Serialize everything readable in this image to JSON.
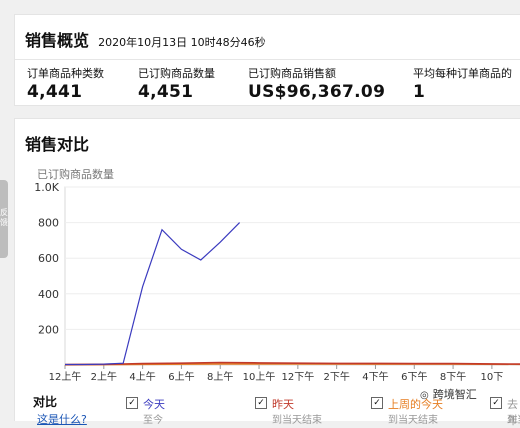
{
  "sales_overview": {
    "title": "销售概览",
    "timestamp": "2020年10月13日 10时48分46秒",
    "metrics": [
      {
        "label": "订单商品种类数",
        "value": "4,441"
      },
      {
        "label": "已订购商品数量",
        "value": "4,451"
      },
      {
        "label": "已订购商品销售额",
        "value": "US$96,367.09"
      },
      {
        "label": "平均每种订单商品的",
        "value": "1"
      }
    ]
  },
  "sales_comparison": {
    "title": "销售对比",
    "legend_title": "对比",
    "legend_link": "这是什么?",
    "series_labels": [
      {
        "name": "今天",
        "sub": "至今",
        "color": "#3b3bbf"
      },
      {
        "name": "昨天",
        "sub": "到当天结束",
        "color": "#c0392b"
      },
      {
        "name": "上周的今天",
        "sub": "到当天结束",
        "color": "#e67e22"
      },
      {
        "name": "去年",
        "sub": "到当",
        "color": "#999999"
      }
    ]
  },
  "chart_data": {
    "type": "line",
    "ylabel": "已订购商品数量",
    "ylim": [
      0,
      1000
    ],
    "yticks": [
      0,
      200,
      400,
      600,
      800,
      1000
    ],
    "ytick_labels": [
      "",
      "200",
      "400",
      "600",
      "800",
      "1.0K"
    ],
    "xticks": [
      0,
      2,
      4,
      6,
      8,
      10,
      12,
      14,
      16,
      18,
      20,
      22
    ],
    "xtick_labels": [
      "12上午",
      "2上午",
      "4上午",
      "6上午",
      "8上午",
      "10上午",
      "12下午",
      "2下午",
      "4下午",
      "6下午",
      "8下午",
      "10下"
    ],
    "xlim": [
      0,
      23.5
    ],
    "series": [
      {
        "name": "今天",
        "color": "#3b3bbf",
        "x": [
          0,
          1,
          2,
          3,
          4,
          5,
          6,
          7,
          8,
          9
        ],
        "y": [
          3,
          3,
          5,
          10,
          440,
          760,
          650,
          590,
          690,
          800
        ]
      },
      {
        "name": "昨天",
        "color": "#c0392b",
        "x": [
          0,
          2,
          4,
          6,
          8,
          10,
          12,
          14,
          16,
          18,
          20,
          22,
          23.5
        ],
        "y": [
          2,
          4,
          8,
          10,
          14,
          12,
          10,
          9,
          9,
          8,
          8,
          6,
          5
        ]
      },
      {
        "name": "上周的今天",
        "color": "#e67e22",
        "x": [
          0,
          4,
          8,
          12,
          16,
          20,
          23.5
        ],
        "y": [
          1,
          4,
          6,
          6,
          5,
          5,
          4
        ]
      }
    ]
  },
  "side_tab": {
    "line1": "反",
    "line2": "馈"
  },
  "watermark": {
    "text": "跨境智汇"
  },
  "icons": {
    "watermark": "wechat-icon"
  }
}
